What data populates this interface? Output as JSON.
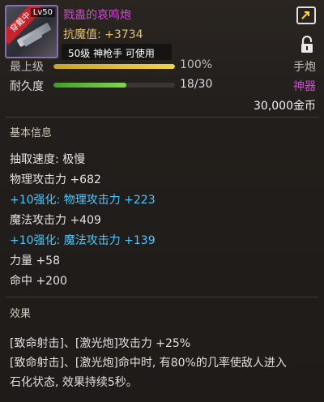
{
  "item": {
    "name": "戮蛊的哀鸣炮",
    "anti_magic": "抗魔值: +3734",
    "level_class_usable": "50级  神枪手  可使用",
    "equipped_badge": "穿戴中",
    "level_corner": "Lv50"
  },
  "upper_rows": {
    "row1_label": "最上级",
    "row1_value": "100%",
    "row1_fill": 1.0,
    "row1_right": "手炮"
  },
  "durability": {
    "label": "耐久度",
    "value": "18/30",
    "fill": 0.6,
    "grade": "神器"
  },
  "price": "30,000金币",
  "basic_info": {
    "title": "基本信息",
    "stats": [
      {
        "text": "抽取速度: 极慢",
        "type": "normal"
      },
      {
        "text": "物理攻击力 +682",
        "type": "normal"
      },
      {
        "text": "+10强化: 物理攻击力 +223",
        "type": "enhance"
      },
      {
        "text": "魔法攻击力 +409",
        "type": "normal"
      },
      {
        "text": "+10强化: 魔法攻击力 +139",
        "type": "enhance"
      },
      {
        "text": "力量 +58",
        "type": "normal"
      },
      {
        "text": "命中 +200",
        "type": "normal"
      }
    ]
  },
  "effects": {
    "title": "效果",
    "lines": [
      "[致命射击]、[激光炮]攻击力 +25%",
      "[致命射击]、[激光炮]命中时, 有80%的几率使敌人进入",
      "石化状态, 效果持续5秒。"
    ]
  },
  "colors": {
    "name": "#d447d4",
    "anti_magic": "#e3c16a",
    "enhance": "#4bc7ff",
    "grade": "#d447d4",
    "upper_bar": "#e1c23a",
    "durability_bar": "#5cc43a"
  }
}
